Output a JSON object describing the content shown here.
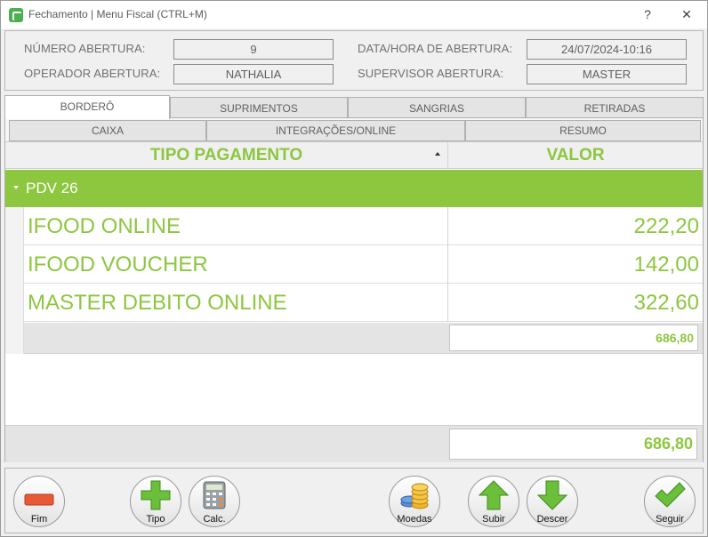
{
  "window": {
    "title": "Fechamento | Menu Fiscal (CTRL+M)",
    "help_label": "?",
    "close_label": "✕"
  },
  "header": {
    "numero_abertura_label": "NÚMERO ABERTURA:",
    "numero_abertura_value": "9",
    "data_hora_label": "DATA/HORA DE ABERTURA:",
    "data_hora_value": "24/07/2024-10:16",
    "operador_label": "OPERADOR ABERTURA:",
    "operador_value": "NATHALIA",
    "supervisor_label": "SUPERVISOR ABERTURA:",
    "supervisor_value": "MASTER"
  },
  "tabs_main": [
    {
      "label": "BORDERÔ",
      "active": true
    },
    {
      "label": "SUPRIMENTOS",
      "active": false
    },
    {
      "label": "SANGRIAS",
      "active": false
    },
    {
      "label": "RETIRADAS",
      "active": false
    }
  ],
  "tabs_sub": [
    {
      "label": "CAIXA",
      "active": false
    },
    {
      "label": "INTEGRAÇÕES/ONLINE",
      "active": true
    },
    {
      "label": "RESUMO",
      "active": false
    }
  ],
  "grid": {
    "col_tipo": "TIPO PAGAMENTO",
    "col_valor": "VALOR",
    "group_label": "PDV 26",
    "rows": [
      {
        "tipo": "IFOOD ONLINE",
        "valor": "222,20"
      },
      {
        "tipo": "IFOOD VOUCHER",
        "valor": "142,00"
      },
      {
        "tipo": "MASTER DEBITO ONLINE",
        "valor": "322,60"
      }
    ],
    "group_total": "686,80",
    "grand_total": "686,80"
  },
  "toolbar": {
    "fim": "Fim",
    "tipo": "Tipo",
    "calc": "Calc.",
    "moedas": "Moedas",
    "subir": "Subir",
    "descer": "Descer",
    "seguir": "Seguir"
  },
  "colors": {
    "accent_green": "#8dc63f",
    "highlight_red": "#e0212b"
  }
}
